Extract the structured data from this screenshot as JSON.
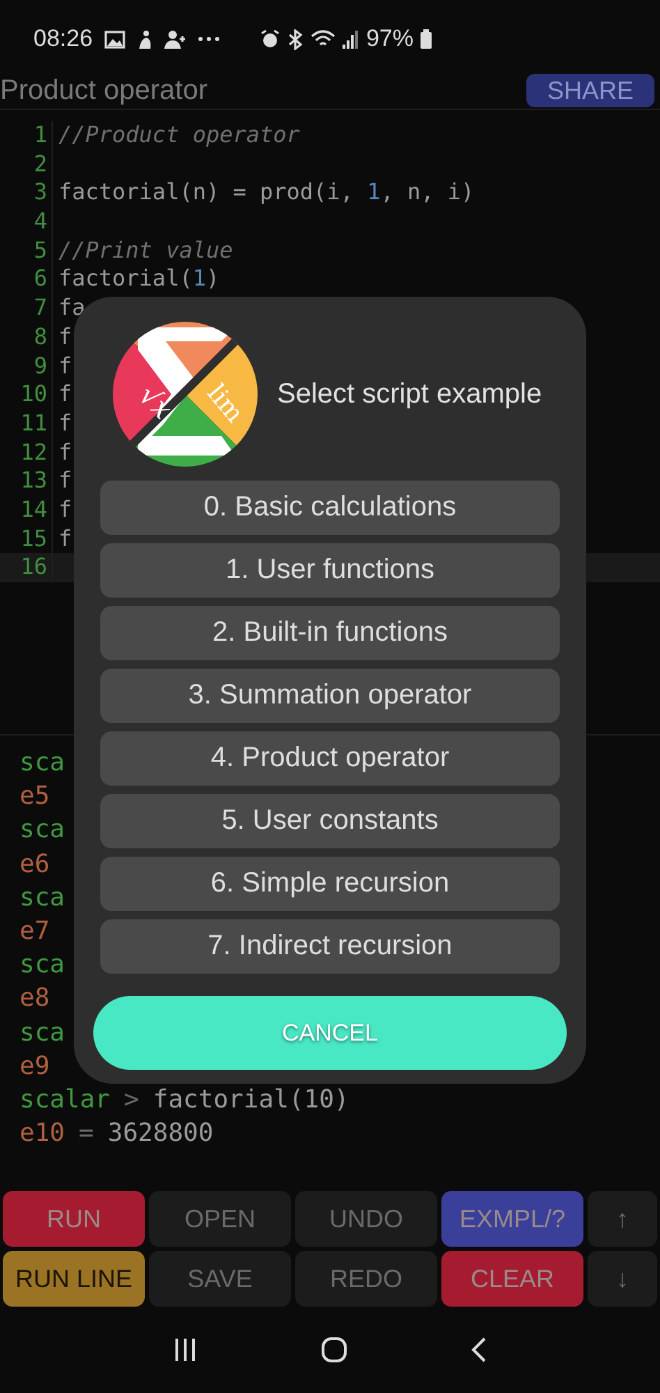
{
  "status_bar": {
    "time": "08:26",
    "battery": "97%"
  },
  "title_bar": {
    "title": "Product operator",
    "share": "SHARE"
  },
  "editor": {
    "lines": [
      {
        "number": "1",
        "current": false,
        "tokens": [
          {
            "kind": "comment",
            "text": "//Product operator"
          }
        ]
      },
      {
        "number": "2",
        "current": false
      },
      {
        "number": "3",
        "current": false,
        "tokens": [
          {
            "kind": "code",
            "text": "factorial(n) = prod(i, "
          },
          {
            "kind": "number",
            "text": "1"
          },
          {
            "kind": "code",
            "text": ", n, i)"
          }
        ]
      },
      {
        "number": "4",
        "current": false
      },
      {
        "number": "5",
        "current": false,
        "tokens": [
          {
            "kind": "comment",
            "text": "//Print value"
          }
        ]
      },
      {
        "number": "6",
        "current": false,
        "tokens": [
          {
            "kind": "code",
            "text": "factorial("
          },
          {
            "kind": "number",
            "text": "1"
          },
          {
            "kind": "code",
            "text": ")"
          }
        ]
      },
      {
        "number": "7",
        "current": false,
        "tokens": [
          {
            "kind": "code",
            "text": "fa"
          }
        ]
      },
      {
        "number": "8",
        "current": false,
        "tokens": [
          {
            "kind": "code",
            "text": "f"
          }
        ]
      },
      {
        "number": "9",
        "current": false,
        "tokens": [
          {
            "kind": "code",
            "text": "f"
          }
        ]
      },
      {
        "number": "10",
        "current": false,
        "tokens": [
          {
            "kind": "code",
            "text": "f"
          }
        ]
      },
      {
        "number": "11",
        "current": false,
        "tokens": [
          {
            "kind": "code",
            "text": "f"
          }
        ]
      },
      {
        "number": "12",
        "current": false,
        "tokens": [
          {
            "kind": "code",
            "text": "f"
          }
        ]
      },
      {
        "number": "13",
        "current": false,
        "tokens": [
          {
            "kind": "code",
            "text": "f"
          }
        ]
      },
      {
        "number": "14",
        "current": false,
        "tokens": [
          {
            "kind": "code",
            "text": "f"
          }
        ]
      },
      {
        "number": "15",
        "current": false,
        "tokens": [
          {
            "kind": "code",
            "text": "f"
          }
        ]
      },
      {
        "number": "16",
        "current": true
      }
    ]
  },
  "console": {
    "lines": [
      [
        {
          "kind": "prompt",
          "text": "sca"
        }
      ],
      [
        {
          "kind": "result",
          "text": "e5"
        }
      ],
      [
        {
          "kind": "prompt",
          "text": "sca"
        }
      ],
      [
        {
          "kind": "result",
          "text": "e6"
        }
      ],
      [
        {
          "kind": "prompt",
          "text": "sca"
        }
      ],
      [
        {
          "kind": "result",
          "text": "e7"
        }
      ],
      [
        {
          "kind": "prompt",
          "text": "sca"
        }
      ],
      [
        {
          "kind": "result",
          "text": "e8"
        }
      ],
      [
        {
          "kind": "prompt",
          "text": "sca"
        }
      ],
      [
        {
          "kind": "result",
          "text": "e9"
        }
      ],
      [
        {
          "kind": "prompt",
          "text": "scalar"
        },
        {
          "kind": "op",
          "text": ">"
        },
        {
          "kind": "text",
          "text": "factorial(10)"
        }
      ],
      [
        {
          "kind": "result",
          "text": "e10"
        },
        {
          "kind": "op",
          "text": "="
        },
        {
          "kind": "text",
          "text": "3628800"
        }
      ]
    ]
  },
  "buttons": [
    {
      "label": "RUN",
      "color": "#a51c30",
      "disabled": false
    },
    {
      "label": "OPEN",
      "color": "#1c1c1c",
      "disabled": true
    },
    {
      "label": "UNDO",
      "color": "#1c1c1c",
      "disabled": true
    },
    {
      "label": "EXMPL/?",
      "color": "#3a3f9a",
      "disabled": false
    },
    {
      "label": "↑",
      "color": "#1c1c1c",
      "disabled": true
    },
    {
      "label": "RUN LINE",
      "color": "#9a7424",
      "disabled": false
    },
    {
      "label": "SAVE",
      "color": "#1c1c1c",
      "disabled": true
    },
    {
      "label": "REDO",
      "color": "#1c1c1c",
      "disabled": true
    },
    {
      "label": "CLEAR",
      "color": "#a51c30",
      "disabled": false
    },
    {
      "label": "↓",
      "color": "#1c1c1c",
      "disabled": true
    }
  ],
  "dialog": {
    "logo": {
      "left": "√x",
      "right": "lim"
    },
    "title": "Select script example",
    "items": [
      "0. Basic calculations",
      "1. User functions",
      "2. Built-in functions",
      "3. Summation operator",
      "4. Product operator",
      "5. User constants",
      "6. Simple recursion",
      "7. Indirect recursion"
    ],
    "cancel": "CANCEL"
  }
}
